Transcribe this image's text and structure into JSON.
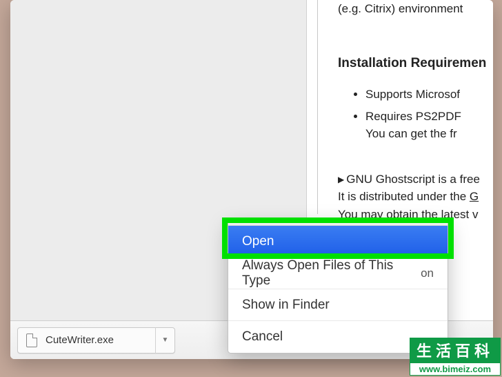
{
  "page": {
    "citrix_line": "(e.g. Citrix) environment",
    "req_heading": "Installation Requiremen",
    "li1": "Supports Microsof",
    "li2a": "Requires PS2PDF",
    "li2b": "You can get the fr",
    "gnu1_prefix": "GNU Ghostscript is a free",
    "gnu2_a": "It is distributed under the ",
    "gnu2_b": "G",
    "gnu3": "You may obtain the latest v"
  },
  "download": {
    "filename": "CuteWriter.exe"
  },
  "menu": {
    "open": "Open",
    "always": "Always Open Files of This Type",
    "always_trail": "on",
    "show": "Show in Finder",
    "cancel": "Cancel"
  },
  "watermark": {
    "title": "生活百科",
    "url": "www.bimeiz.com"
  }
}
